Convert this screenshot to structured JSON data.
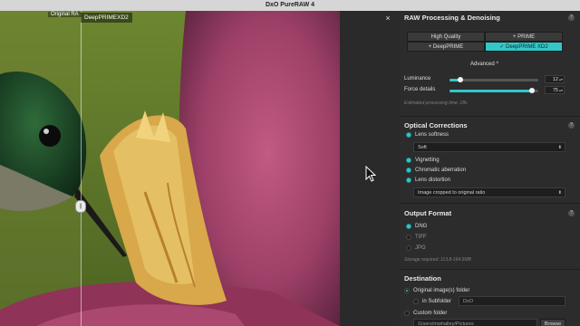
{
  "window": {
    "title": "DxO PureRAW 4"
  },
  "viewer": {
    "original_label": "Original RA",
    "processed_label": "DeepPRIMEXD2",
    "split_handle": "||"
  },
  "panel": {
    "close_label": "×",
    "raw": {
      "title": "RAW Processing & Denoising",
      "methods": [
        {
          "label": "High Quality",
          "active": false
        },
        {
          "label": "+ PRIME",
          "active": false
        },
        {
          "label": "+ DeepPRIME",
          "active": false
        },
        {
          "label": "✓ DeepPRIME XD2",
          "active": true
        }
      ],
      "advanced_label": "Advanced ^",
      "luminance": {
        "label": "Luminance",
        "value": "12",
        "fraction": 0.12
      },
      "force_details": {
        "label": "Force details",
        "value": "75",
        "fraction": 0.93
      },
      "estimate": "Estimated processing time: 18s"
    },
    "optical": {
      "title": "Optical Corrections",
      "lens_softness": "Lens softness",
      "softness_select": "Soft",
      "vignetting": "Vignetting",
      "chromatic": "Chromatic aberration",
      "distortion": "Lens distortion",
      "distortion_select": "Image cropped to original ratio"
    },
    "output": {
      "title": "Output Format",
      "formats": [
        "DNG",
        "TIFF",
        "JPG"
      ],
      "storage": "Storage required: 113.8-164.5MB"
    },
    "destination": {
      "title": "Destination",
      "original_folder": "Original image(s) folder",
      "in_subfolder": "in Subfolder",
      "subfolder_value": "DxO",
      "custom_folder": "Custom folder",
      "custom_path": "/Users/mwhalley/Pictures",
      "browse": "Browse"
    },
    "help_label": "?"
  },
  "colors": {
    "accent": "#33c7c7",
    "panel_bg": "#2c2c2c"
  }
}
